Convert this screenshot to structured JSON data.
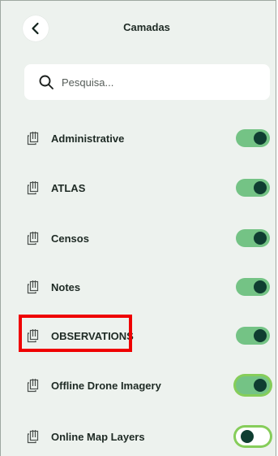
{
  "header": {
    "title": "Camadas"
  },
  "search": {
    "placeholder": "Pesquisa..."
  },
  "layers": [
    {
      "label": "Administrative",
      "enabled": true
    },
    {
      "label": "ATLAS",
      "enabled": true
    },
    {
      "label": "Censos",
      "enabled": true
    },
    {
      "label": "Notes",
      "enabled": true
    },
    {
      "label": "OBSERVATIONS",
      "enabled": true
    },
    {
      "label": "Offline Drone Imagery",
      "enabled": true
    },
    {
      "label": "Online Map Layers",
      "enabled": false
    }
  ],
  "colors": {
    "panel_bg": "#edf2ee",
    "toggle_on": "#74c385",
    "toggle_knob": "#0f3d31",
    "focus_ring": "#86cd5a",
    "highlight": "#ef0000"
  }
}
